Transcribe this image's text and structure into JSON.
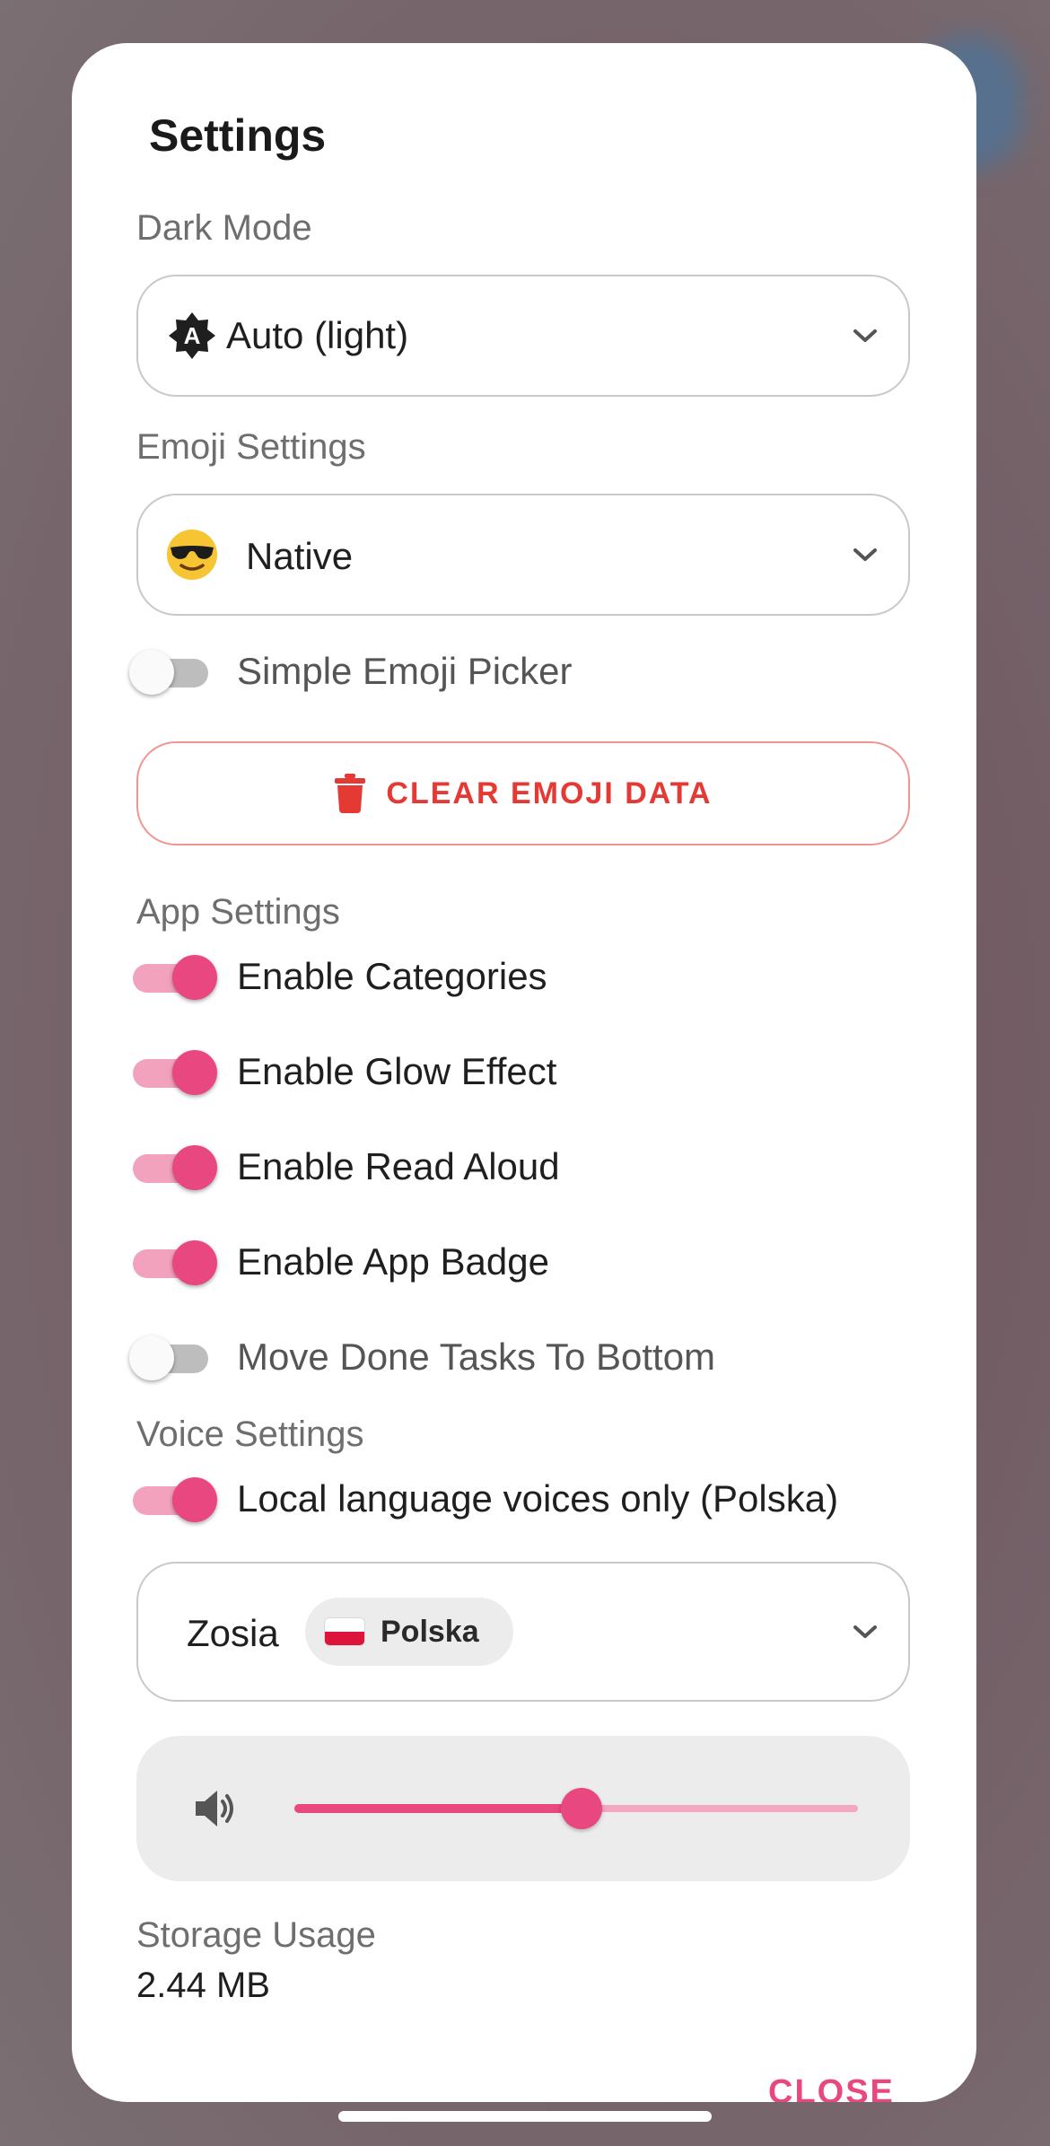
{
  "dialog": {
    "title": "Settings",
    "close_label": "CLOSE"
  },
  "dark_mode": {
    "label": "Dark Mode",
    "selected": "Auto (light)",
    "badge_letter": "A"
  },
  "emoji": {
    "label": "Emoji Settings",
    "selected": "Native",
    "simple_picker": {
      "label": "Simple Emoji Picker",
      "on": false
    },
    "clear_label": "CLEAR EMOJI DATA"
  },
  "app_settings": {
    "label": "App Settings",
    "toggles": [
      {
        "label": "Enable Categories",
        "on": true
      },
      {
        "label": "Enable Glow Effect",
        "on": true
      },
      {
        "label": "Enable Read Aloud",
        "on": true
      },
      {
        "label": "Enable App Badge",
        "on": true
      },
      {
        "label": "Move Done Tasks To Bottom",
        "on": false
      }
    ]
  },
  "voice": {
    "label": "Voice Settings",
    "local_only": {
      "label": "Local language voices only (Polska)",
      "on": true
    },
    "selected_voice": "Zosia",
    "language_chip": "Polska",
    "volume": 0.51
  },
  "storage": {
    "label": "Storage Usage",
    "value": "2.44 MB"
  },
  "colors": {
    "accent": "#e94780",
    "accent_light": "#f3a2bd",
    "danger": "#e53a33",
    "toggle_off_track": "#bdbdbd"
  },
  "icons": {
    "dark_mode": "auto-brightness-icon",
    "emoji": "sunglasses-face-icon",
    "clear": "trash-icon",
    "volume": "speaker-icon",
    "dropdown": "chevron-down-icon",
    "flag": "poland-flag-icon"
  }
}
